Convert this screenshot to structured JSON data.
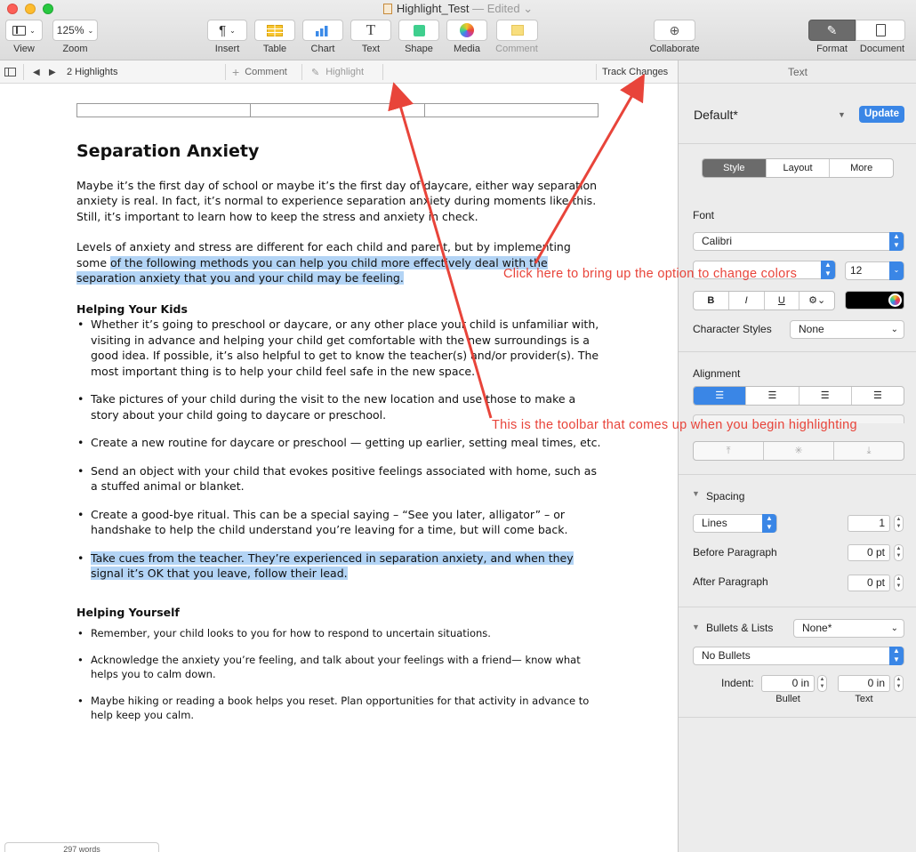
{
  "window": {
    "title": "Highlight_Test",
    "edited": "— Edited ⌄"
  },
  "toolbar": {
    "view_label": "View",
    "zoom_value": "125%",
    "zoom_label": "Zoom",
    "insert_label": "Insert",
    "table_label": "Table",
    "chart_label": "Chart",
    "text_label": "Text",
    "shape_label": "Shape",
    "media_label": "Media",
    "comment_label": "Comment",
    "collaborate_label": "Collaborate",
    "format_label": "Format",
    "document_label": "Document"
  },
  "subbar": {
    "highlights_count": "2 Highlights",
    "comment_label": "Comment",
    "highlight_label": "Highlight",
    "track_changes_label": "Track Changes"
  },
  "document": {
    "title": "Separation Anxiety",
    "para1": "Maybe it’s the first day of school or maybe it’s the first day of daycare, either way separation anxiety is real. In fact, it’s normal to experience separation anxiety during moments like this. Still, it’s important to learn how to keep the stress and anxiety in check.",
    "para2_plain": "Levels of anxiety and stress are different for each child and parent, but by implementing some ",
    "para2_highlighted": "of the following methods you can help you child more effectively deal with the separation anxiety that you and your child may be feeling.",
    "heading_kids": "Helping Your Kids",
    "kids_items": [
      "Whether it’s going to preschool or daycare, or any other place your child is unfamiliar with, visiting in advance and helping your child get comfortable with the new surroundings is a good idea. If possible, it’s also helpful to get to know the teacher(s) and/or provider(s). The most important thing is to help your child feel safe in the new space.",
      "Take pictures of your child during the visit to the new location and use  those to make a story about your child going to daycare or preschool.",
      "Create a new routine for daycare or preschool — getting up earlier, setting meal times, etc.",
      "Send an object with your child that evokes positive feelings associated with home, such as a stuffed animal or blanket.",
      "Create a good-bye ritual. This can be a special saying – “See you later, alligator” – or handshake to help the child understand you’re leaving for a time, but will come back.",
      "Take cues from the teacher. They’re experienced in separation anxiety, and when they signal it’s OK that you leave, follow their lead."
    ],
    "heading_yourself": "Helping Yourself",
    "yourself_items": [
      "Remember, your child looks to you for how to respond to uncertain situations.",
      "Acknowledge the anxiety you’re feeling, and talk about your feelings with a friend— know what helps you to calm down.",
      "Maybe hiking or reading a book helps you reset. Plan opportunities for that activity in advance to help keep you calm."
    ],
    "word_count": "297 words"
  },
  "annotations": {
    "colors_note": "Click here to bring up the option to  change colors",
    "toolbar_note": "This is the toolbar that comes up when you begin highlighting",
    "color": "#e8443a"
  },
  "inspector": {
    "header": "Text",
    "paragraph_style": "Default*",
    "update_label": "Update",
    "tabs": [
      "Style",
      "Layout",
      "More"
    ],
    "font_label": "Font",
    "font_name": "Calibri",
    "font_size": "12",
    "bold": "B",
    "italic": "I",
    "underline": "U",
    "gear": "⚙⌄",
    "char_styles_label": "Character Styles",
    "char_styles_value": "None",
    "alignment_label": "Alignment",
    "spacing_label": "Spacing",
    "spacing_mode": "Lines",
    "spacing_value": "1",
    "before_label": "Before Paragraph",
    "before_value": "0 pt",
    "after_label": "After Paragraph",
    "after_value": "0 pt",
    "bullets_label": "Bullets & Lists",
    "bullets_value": "None*",
    "bullets_type": "No Bullets",
    "indent_label": "Indent:",
    "indent_bullet_value": "0 in",
    "indent_text_value": "0 in",
    "indent_bullet_label": "Bullet",
    "indent_text_label": "Text"
  },
  "colors": {
    "accent_blue": "#3a86e6",
    "highlight": "#b3d4f5"
  }
}
